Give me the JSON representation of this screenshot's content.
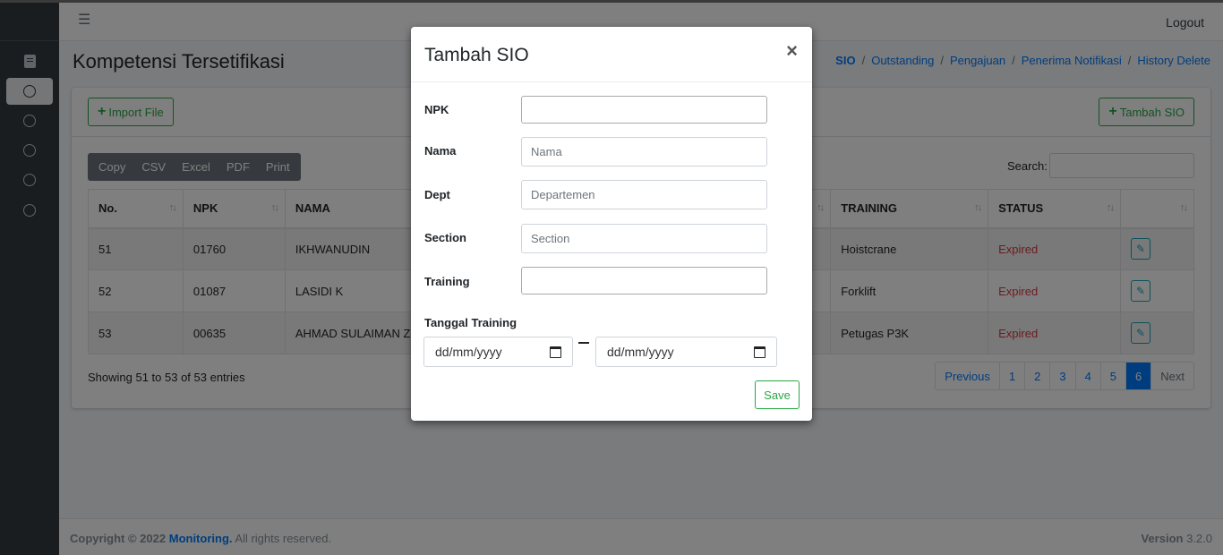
{
  "navbar": {
    "menu_icon": "hamburger-icon",
    "logout": "Logout"
  },
  "sidebar": {
    "icons": [
      "book-icon",
      "circle-icon",
      "circle-icon",
      "circle-icon",
      "circle-icon",
      "circle-icon"
    ]
  },
  "page": {
    "title": "Kompetensi Tersetifikasi",
    "breadcrumb": [
      "SIO",
      "Outstanding",
      "Pengajuan",
      "Penerima Notifikasi",
      "History Delete"
    ]
  },
  "toolbar": {
    "import_label": "Import File",
    "add_label": "Tambah SIO",
    "export_buttons": [
      "Copy",
      "CSV",
      "Excel",
      "PDF",
      "Print"
    ],
    "search_label": "Search:",
    "search_value": ""
  },
  "table": {
    "columns": [
      "No.",
      "NPK",
      "NAMA",
      "TRAINING",
      "STATUS",
      ""
    ],
    "rows": [
      {
        "no": "51",
        "npk": "01760",
        "nama": "IKHWANUDIN",
        "training": "Hoistcrane",
        "status": "Expired"
      },
      {
        "no": "52",
        "npk": "01087",
        "nama": "LASIDI K",
        "training": "Forklift",
        "status": "Expired"
      },
      {
        "no": "53",
        "npk": "00635",
        "nama": "AHMAD SULAIMAN Z",
        "training": "Petugas P3K",
        "status": "Expired"
      }
    ],
    "info": "Showing 51 to 53 of 53 entries"
  },
  "pagination": {
    "prev": "Previous",
    "pages": [
      "1",
      "2",
      "3",
      "4",
      "5",
      "6"
    ],
    "current": "6",
    "next": "Next"
  },
  "footer": {
    "copyright": "Copyright © 2022",
    "brand": "Monitoring.",
    "rights": "All rights reserved.",
    "version_label": "Version",
    "version": "3.2.0"
  },
  "modal": {
    "title": "Tambah SIO",
    "close": "×",
    "fields": {
      "npk": {
        "label": "NPK",
        "value": ""
      },
      "nama": {
        "label": "Nama",
        "placeholder": "Nama"
      },
      "dept": {
        "label": "Dept",
        "placeholder": "Departemen"
      },
      "section": {
        "label": "Section",
        "placeholder": "Section"
      },
      "training": {
        "label": "Training",
        "value": ""
      },
      "tanggal": {
        "label": "Tanggal Training",
        "start_placeholder": "dd/mm/yyyy",
        "end_placeholder": "dd/mm/yyyy"
      }
    },
    "save": "Save"
  },
  "colors": {
    "primary": "#007bff",
    "success": "#28a745",
    "danger": "#dc3545",
    "info": "#17a2b8",
    "sidebar": "#343a40"
  }
}
